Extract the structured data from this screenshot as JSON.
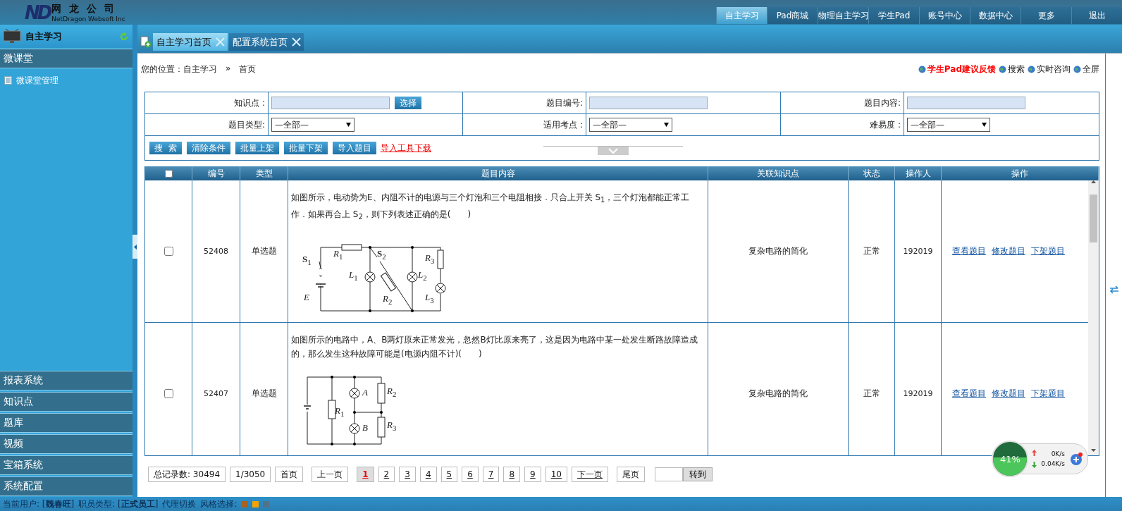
{
  "header": {
    "logo_mark": "ND",
    "logo_name": "网 龙 公 司",
    "logo_sub": "NetDragon Websoft Inc",
    "nav": [
      {
        "label": "自主学习",
        "selected": true
      },
      {
        "label": "Pad商城",
        "selected": false
      },
      {
        "label": "物理自主学习",
        "selected": false
      },
      {
        "label": "学生Pad",
        "selected": false
      },
      {
        "label": "账号中心",
        "selected": false
      },
      {
        "label": "数据中心",
        "selected": false
      },
      {
        "label": "更多",
        "selected": false
      },
      {
        "label": "退出",
        "selected": false
      }
    ]
  },
  "sidebar": {
    "title": "自主学习",
    "sections": [
      {
        "label": "微课堂",
        "children": [
          {
            "label": "微课堂管理"
          }
        ]
      },
      {
        "label": "报表系统"
      },
      {
        "label": "知识点"
      },
      {
        "label": "题库"
      },
      {
        "label": "视频"
      },
      {
        "label": "宝箱系统"
      },
      {
        "label": "系统配置"
      }
    ]
  },
  "tabs": [
    {
      "label": "自主学习首页",
      "selected": true
    },
    {
      "label": "配置系统首页",
      "selected": false
    }
  ],
  "breadcrumb": [
    "您的位置：自主学习",
    "»",
    "首页"
  ],
  "quick_links": [
    {
      "label": "学生Pad建议反馈",
      "kind": "highlight"
    },
    {
      "label": "搜索",
      "kind": "normal"
    },
    {
      "label": "实时咨询",
      "kind": "normal"
    },
    {
      "label": "全屏",
      "kind": "normal"
    }
  ],
  "filters": [
    {
      "label": "知识点 :",
      "kind": "picker",
      "button": "选择"
    },
    {
      "label": "题目编号:",
      "kind": "text"
    },
    {
      "label": "题目内容:",
      "kind": "text"
    },
    {
      "label": "题目类型:",
      "kind": "select",
      "value": "—全部—"
    },
    {
      "label": "适用考点 :",
      "kind": "select",
      "value": "—全部—"
    },
    {
      "label": "难易度 :",
      "kind": "select",
      "value": "—全部—"
    }
  ],
  "actions": [
    {
      "label": "搜  索",
      "kind": "button"
    },
    {
      "label": "清除条件",
      "kind": "button"
    },
    {
      "label": "批量上架",
      "kind": "button"
    },
    {
      "label": "批量下架",
      "kind": "button"
    },
    {
      "label": "导入题目",
      "kind": "button"
    },
    {
      "label": "导入工具下载",
      "kind": "link"
    }
  ],
  "table": {
    "columns": [
      "编号",
      "类型",
      "题目内容",
      "关联知识点",
      "状态",
      "操作人",
      "操作"
    ],
    "all_checked": false,
    "rows": [
      {
        "checked": false,
        "id": "52408",
        "type": "单选题",
        "question": "如图所示，电动势为E、内阻不计的电源与三个灯泡和三个电阻相接．只合上开关 S$_{1}$，三个灯泡都能正常工作．如果再合上 S$_{2}$，则下列表述正确的是(　　)",
        "diagram": {
          "kind": "circuit_a",
          "labels": [
            "**S**$_{1}$",
            "*R*$_{1}$",
            "**S**$_{2}$",
            "*R*$_{3}$",
            "*L*$_{1}$",
            "*L*$_{2}$",
            "*E*",
            "*R*$_{2}$",
            "*L*$_{3}$"
          ]
        },
        "topic": "复杂电路的简化",
        "status": "正常",
        "operator": "192019",
        "links": [
          "查看题目",
          "修改题目",
          "下架题目"
        ]
      },
      {
        "checked": false,
        "id": "52407",
        "type": "单选题",
        "question": "如图所示的电路中，A、B两灯原来正常发光，忽然B灯比原来亮了，这是因为电路中某一处发生断路故障造成的，那么发生这种故障可能是(电源内阻不计)(　　)",
        "diagram": {
          "kind": "circuit_b",
          "labels": [
            "*R*$_{1}$",
            "*A*",
            "*B*",
            "*R*$_{2}$",
            "*R*$_{3}$"
          ]
        },
        "topic": "复杂电路的简化",
        "status": "正常",
        "operator": "192019",
        "links": [
          "查看题目",
          "修改题目",
          "下架题目"
        ]
      }
    ]
  },
  "pagination": {
    "total": "总记录数: 30494",
    "page_of": "1/3050",
    "first": "首页",
    "prev": "上一页",
    "pages": [
      {
        "label": "1",
        "selected": true
      },
      {
        "label": "2",
        "selected": false
      },
      {
        "label": "3",
        "selected": false
      },
      {
        "label": "4",
        "selected": false
      },
      {
        "label": "5",
        "selected": false
      },
      {
        "label": "6",
        "selected": false
      },
      {
        "label": "7",
        "selected": false
      },
      {
        "label": "8",
        "selected": false
      },
      {
        "label": "9",
        "selected": false
      },
      {
        "label": "10",
        "selected": false
      }
    ],
    "next": "下一页",
    "last": "尾页",
    "go": "转到"
  },
  "net_widget": {
    "percent": "41%",
    "up": "0K/s",
    "down": "0.04K/s"
  },
  "status_bar": {
    "texts": [
      "当前用户: [**魏春旺**]",
      "职员类型: [**正式员工**]",
      "代理切换",
      "风格选择:"
    ],
    "styles": [
      {
        "color": "#a8611f"
      },
      {
        "color": "#f5a300"
      },
      {
        "color": "#4f7389"
      }
    ]
  }
}
